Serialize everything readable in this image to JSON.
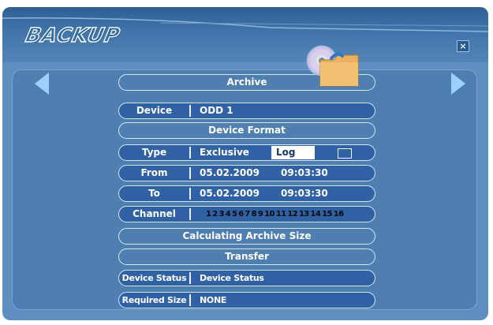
{
  "header": {
    "title": "BACKUP",
    "close_label": "×"
  },
  "buttons": {
    "archive": "Archive",
    "device_format": "Device Format",
    "calculating": "Calculating Archive Size",
    "transfer": "Transfer"
  },
  "rows": {
    "device": {
      "label": "Device",
      "value": "ODD 1"
    },
    "type": {
      "label": "Type",
      "option_exclusive": "Exclusive",
      "option_log": "Log",
      "selected": "Log"
    },
    "from": {
      "label": "From",
      "date": "05.02.2009",
      "time": "09:03:30"
    },
    "to": {
      "label": "To",
      "date": "05.02.2009",
      "time": "09:03:30"
    },
    "channel": {
      "label": "Channel",
      "channels": "1 2 3 4 5 6 7 8 9 10 11 12 13 14 15 16"
    },
    "device_status": {
      "label": "Device Status",
      "value": "Device Status"
    },
    "required_size": {
      "label": "Required Size",
      "value": "NONE"
    }
  },
  "icons": {
    "left": "arrow-left-icon",
    "right": "arrow-right-icon",
    "archive": "disc-folder-icon",
    "close": "close-icon"
  },
  "colors": {
    "frame": "#5f8fc0",
    "panel": "#4f7fb1",
    "field": "#2f61a4",
    "arrow": "#9cd0ff"
  }
}
